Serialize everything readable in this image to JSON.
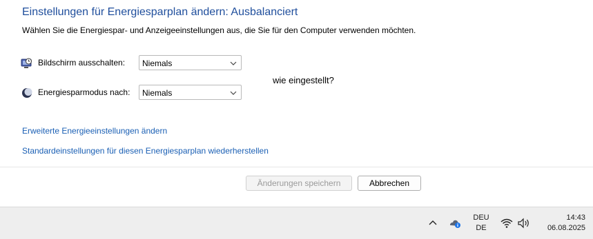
{
  "header": {
    "title": "Einstellungen für Energiesparplan ändern: Ausbalanciert",
    "subtitle": "Wählen Sie die Energiespar- und Anzeigeeinstellungen aus, die Sie für den Computer verwenden möchten."
  },
  "settings": {
    "display": {
      "label": "Bildschirm ausschalten:",
      "value": "Niemals",
      "icon": "monitor-clock-icon"
    },
    "sleep": {
      "label": "Energiesparmodus nach:",
      "value": "Niemals",
      "icon": "moon-icon"
    }
  },
  "floating_text": "wie eingestellt?",
  "links": {
    "advanced": "Erweiterte Energieeinstellungen ändern",
    "restore": "Standardeinstellungen für diesen Energiesparplan wiederherstellen"
  },
  "buttons": {
    "save": "Änderungen speichern",
    "cancel": "Abbrechen"
  },
  "taskbar": {
    "lang_top": "DEU",
    "lang_bottom": "DE",
    "time": "14:43",
    "date": "06.08.2025"
  },
  "colors": {
    "title": "#1f4e9c",
    "link": "#1a5fb4",
    "taskbar_bg": "#eeeeee"
  }
}
